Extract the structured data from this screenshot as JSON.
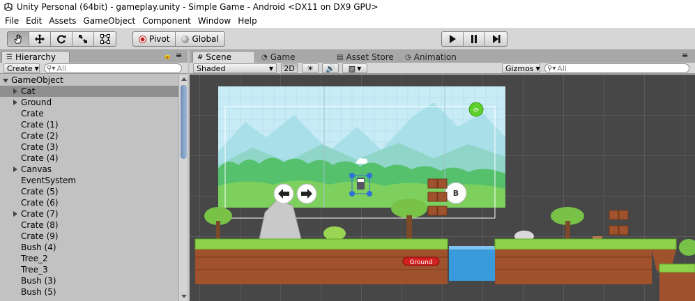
{
  "window": {
    "title": "Unity Personal (64bit) - gameplay.unity - Simple Game - Android <DX11 on DX9 GPU>"
  },
  "menu": [
    "File",
    "Edit",
    "Assets",
    "GameObject",
    "Component",
    "Window",
    "Help"
  ],
  "toolbar": {
    "transform_tools": [
      "hand-icon",
      "move-icon",
      "rotate-icon",
      "scale-icon",
      "rect-tool-icon"
    ],
    "pivot_label": "Pivot",
    "global_label": "Global",
    "play_controls": [
      "play-icon",
      "pause-icon",
      "step-icon"
    ]
  },
  "hierarchy": {
    "tab_label": "Hierarchy",
    "create_label": "Create",
    "search_placeholder": "All",
    "items": [
      {
        "label": "GameObject",
        "indent": 0,
        "expand": "down"
      },
      {
        "label": "Cat",
        "indent": 1,
        "expand": "right",
        "selected": true
      },
      {
        "label": "Ground",
        "indent": 1,
        "expand": "right"
      },
      {
        "label": "Crate",
        "indent": 1
      },
      {
        "label": "Crate (1)",
        "indent": 1
      },
      {
        "label": "Crate (2)",
        "indent": 1
      },
      {
        "label": "Crate (3)",
        "indent": 1
      },
      {
        "label": "Crate (4)",
        "indent": 1
      },
      {
        "label": "Canvas",
        "indent": 1,
        "expand": "right"
      },
      {
        "label": "EventSystem",
        "indent": 1
      },
      {
        "label": "Crate (5)",
        "indent": 1
      },
      {
        "label": "Crate (6)",
        "indent": 1
      },
      {
        "label": "Crate (7)",
        "indent": 1,
        "expand": "right"
      },
      {
        "label": "Crate (8)",
        "indent": 1
      },
      {
        "label": "Crate (9)",
        "indent": 1
      },
      {
        "label": "Bush (4)",
        "indent": 1
      },
      {
        "label": "Tree_2",
        "indent": 1
      },
      {
        "label": "Tree_3",
        "indent": 1
      },
      {
        "label": "Bush (3)",
        "indent": 1
      },
      {
        "label": "Bush (5)",
        "indent": 1
      }
    ]
  },
  "scene": {
    "tabs": [
      {
        "label": "Scene",
        "icon": "grid-icon",
        "active": true
      },
      {
        "label": "Game",
        "icon": "pacman-icon"
      },
      {
        "label": "Asset Store",
        "icon": "store-icon"
      },
      {
        "label": "Animation",
        "icon": "clock-icon"
      }
    ],
    "shading_mode": "Shaded",
    "mode_2d_label": "2D",
    "gizmos_label": "Gizmos",
    "search_placeholder": "All",
    "ground_tag": "Ground",
    "jump_button_label": "B"
  },
  "colors": {
    "sky": "#c8ecf6",
    "grass": "#8ed14a",
    "dirt": "#a0522d",
    "water": "#3a9bdc",
    "selection": "#8f8f8f"
  }
}
